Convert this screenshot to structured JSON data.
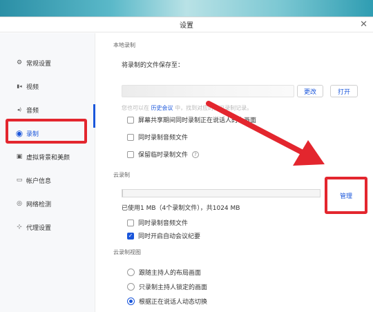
{
  "window": {
    "title": "设置",
    "close_glyph": "✕"
  },
  "sidebar": {
    "items": [
      {
        "label": "常规设置",
        "icon": "gear-icon",
        "glyph": "⚙"
      },
      {
        "label": "视频",
        "icon": "video-icon",
        "glyph": "▮◂"
      },
      {
        "label": "音频",
        "icon": "audio-icon",
        "glyph": "◂)"
      },
      {
        "label": "录制",
        "icon": "record-icon",
        "glyph": "◉",
        "active": true
      },
      {
        "label": "虚拟背景和美颜",
        "icon": "background-icon",
        "glyph": "▣"
      },
      {
        "label": "帐户信息",
        "icon": "account-icon",
        "glyph": "▭"
      },
      {
        "label": "网络检测",
        "icon": "network-icon",
        "glyph": "◎"
      },
      {
        "label": "代理设置",
        "icon": "proxy-icon",
        "glyph": "⊹"
      }
    ]
  },
  "local": {
    "section_title": "本地录制",
    "save_label": "将录制的文件保存至：",
    "change_button": "更改",
    "open_button": "打开",
    "hint_prefix": "您也可以在",
    "hint_link": "历史会议",
    "hint_suffix": "中，找到对应的会议录制记录。",
    "options": [
      {
        "label": "屏幕共享期间同时录制正在说话人的小画面",
        "checked": false
      },
      {
        "label": "同时录制音频文件",
        "checked": false
      },
      {
        "label": "保留临时录制文件",
        "checked": false,
        "help": "?"
      }
    ]
  },
  "cloud": {
    "section_title": "云录制",
    "usage_text": "已使用1 MB（4个录制文件），共1024 MB",
    "usage_fraction": 0.001,
    "manage_button": "管理",
    "options": [
      {
        "label": "同时录制音频文件",
        "checked": false
      },
      {
        "label": "同时开启自动会议纪要",
        "checked": true,
        "check_glyph": "✓"
      }
    ]
  },
  "cloud_view": {
    "section_title": "云录制视图",
    "options": [
      {
        "label": "跟随主持人的布局画面",
        "checked": false
      },
      {
        "label": "只录制主持人锁定的画面",
        "checked": false
      },
      {
        "label": "根据正在说话人动态切换",
        "checked": true
      }
    ]
  },
  "colors": {
    "accent": "#1a56db",
    "highlight": "#e3262e"
  }
}
